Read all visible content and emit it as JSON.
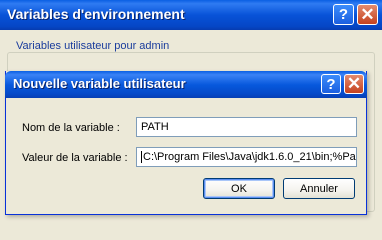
{
  "background_window": {
    "title": "Variables d'environnement",
    "help_glyph": "?",
    "close_glyph": "✕",
    "group_label": "Variables utilisateur pour admin"
  },
  "dialog": {
    "title": "Nouvelle variable utilisateur",
    "help_glyph": "?",
    "close_glyph": "✕",
    "name_label": "Nom de la variable :",
    "name_value": "PATH",
    "value_label": "Valeur de la variable :",
    "value_value": "C:\\Program Files\\Java\\jdk1.6.0_21\\bin;%Pa",
    "ok_label": "OK",
    "cancel_label": "Annuler"
  },
  "icons": {
    "help": "help-icon",
    "close": "close-icon"
  },
  "colors": {
    "titlebar_blue": "#0853d8",
    "window_face": "#ece9d8",
    "close_red": "#c5421f",
    "group_label_blue": "#1a3c9c"
  }
}
